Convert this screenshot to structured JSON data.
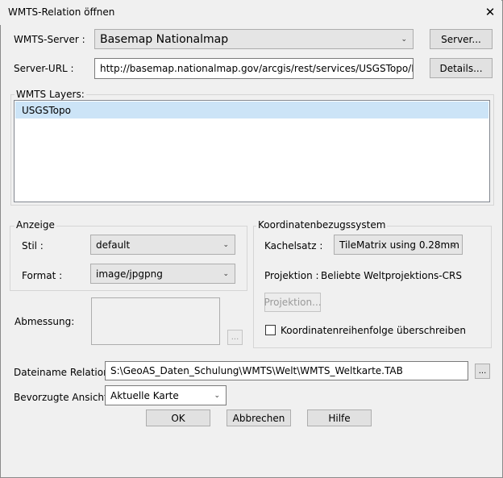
{
  "window": {
    "title": "WMTS-Relation öffnen"
  },
  "server": {
    "label": "WMTS-Server :",
    "selected": "Basemap Nationalmap",
    "button": "Server..."
  },
  "server_url": {
    "label": "Server-URL :",
    "value": "http://basemap.nationalmap.gov/arcgis/rest/services/USGSTopo/MapSe",
    "button": "Details..."
  },
  "layers": {
    "label": "WMTS Layers:",
    "items": [
      "USGSTopo"
    ]
  },
  "anzeige": {
    "title": "Anzeige",
    "stil_label": "Stil :",
    "stil_value": "default",
    "format_label": "Format :",
    "format_value": "image/jpgpng"
  },
  "abmessung": {
    "label": "Abmessung:",
    "button": "..."
  },
  "crs": {
    "title": "Koordinatenbezugssystem",
    "kachelsatz_label": "Kachelsatz :",
    "kachelsatz_value": "TileMatrix using 0.28mm",
    "projektion_label": "Projektion :",
    "projektion_value": "Beliebte Weltprojektions-CRS",
    "projektion_button": "Projektion...",
    "override_label": "Koordinatenreihenfolge überschreiben"
  },
  "dateiname": {
    "label": "Dateiname Relation :",
    "value": "S:\\GeoAS_Daten_Schulung\\WMTS\\Welt\\WMTS_Weltkarte.TAB",
    "button": "..."
  },
  "ansicht": {
    "label": "Bevorzugte Ansicht :",
    "value": "Aktuelle Karte"
  },
  "buttons": {
    "ok": "OK",
    "cancel": "Abbrechen",
    "help": "Hilfe"
  }
}
